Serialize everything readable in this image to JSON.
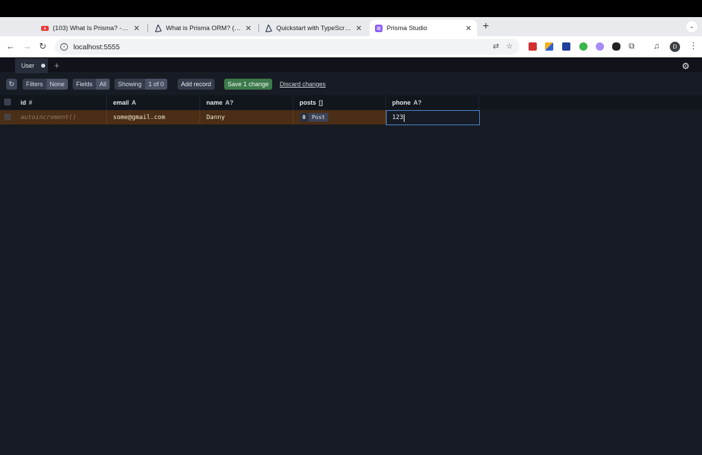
{
  "browser": {
    "tabs": [
      {
        "title": "(103) What Is Prisma? - YouTube",
        "icon": "youtube-icon",
        "active": false
      },
      {
        "title": "What is Prisma ORM? (Overview)",
        "icon": "prisma-icon",
        "active": false
      },
      {
        "title": "Quickstart with TypeScript & SQLite",
        "icon": "prisma-icon",
        "active": false
      },
      {
        "title": "Prisma Studio",
        "icon": "prisma-studio-icon",
        "active": true
      }
    ],
    "new_tab": "+",
    "url": "localhost:5555",
    "profile_initial": "D"
  },
  "app": {
    "model_tab": "User",
    "add_tab": "+",
    "toolbar": {
      "filters_label": "Filters",
      "filters_value": "None",
      "fields_label": "Fields",
      "fields_value": "All",
      "showing_label": "Showing",
      "showing_value": "1 of 0",
      "add_record": "Add record",
      "save": "Save 1 change",
      "discard": "Discard changes"
    },
    "columns": [
      {
        "name": "id",
        "type": "#"
      },
      {
        "name": "email",
        "type": "A"
      },
      {
        "name": "name",
        "type": "A?"
      },
      {
        "name": "posts",
        "type": "[]"
      },
      {
        "name": "phone",
        "type": "A?"
      }
    ],
    "row": {
      "id": "autoincrement()",
      "email": "some@gmail.com",
      "name": "Danny",
      "posts_count": "0",
      "posts_label": "Post",
      "phone": "123"
    }
  },
  "colors": {
    "app_bg": "#171b23",
    "row_dirty": "#4b2e16",
    "save_button": "#3c7a4b",
    "edit_border": "#4a8dd9"
  }
}
